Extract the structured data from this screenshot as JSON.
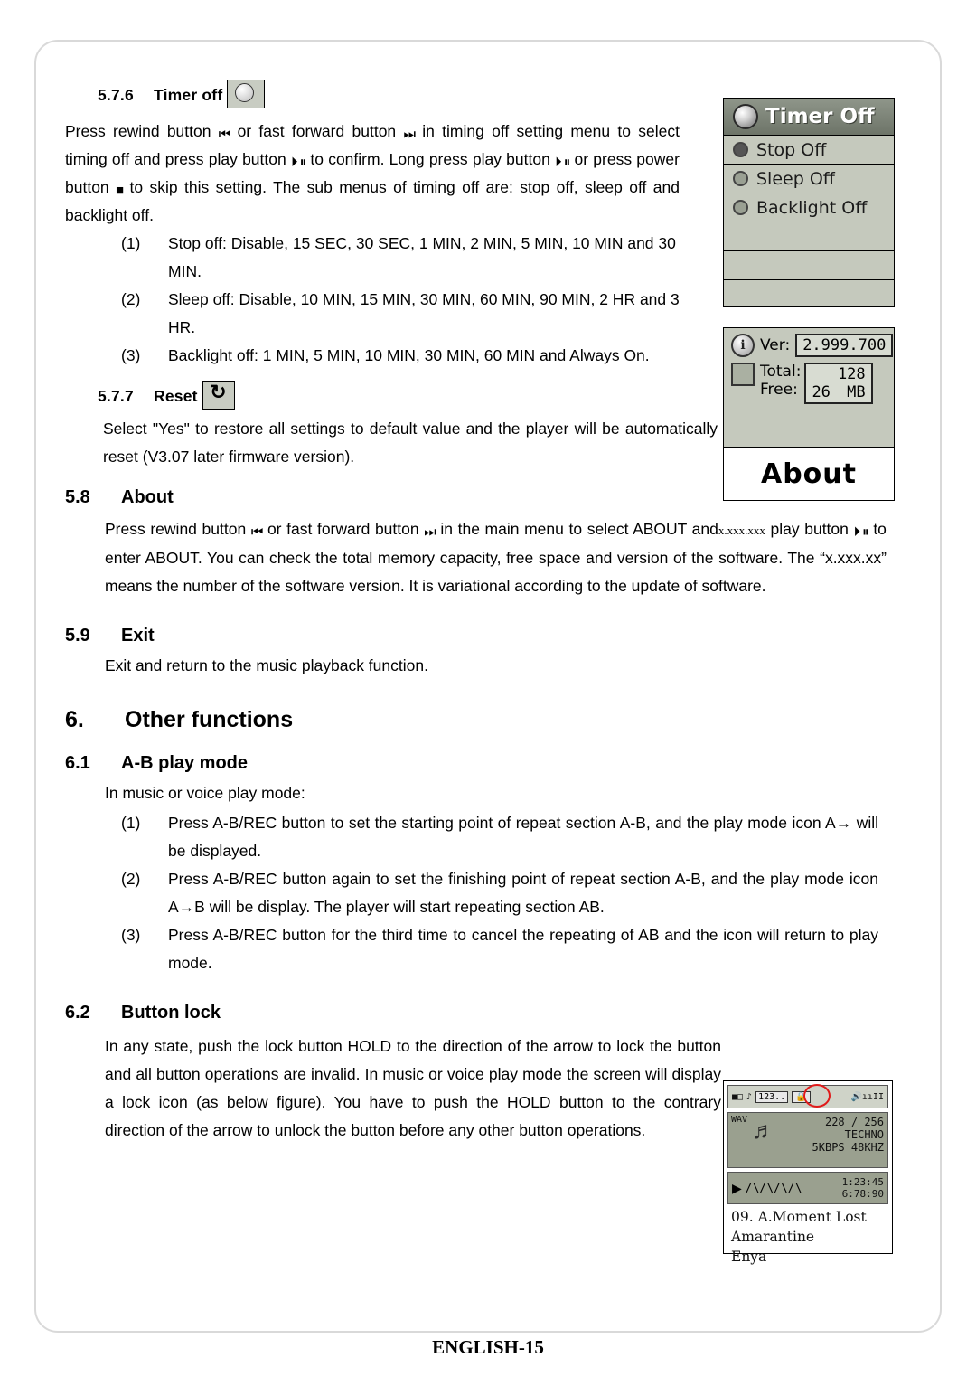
{
  "footer": "ENGLISH-15",
  "sections": {
    "timer_off": {
      "number": "5.7.6",
      "title": "Timer off",
      "icon": "clock-icon",
      "paragraph_parts": {
        "p1": "Press rewind button",
        "p2": "or fast forward button",
        "p3": "in timing off setting menu to select timing off and press play button",
        "p4": "to confirm. Long press play button",
        "p5": "or press power button",
        "p6": "to skip this setting. The sub menus of timing off are: stop off, sleep off and backlight off."
      },
      "list": [
        {
          "mark": "(1)",
          "text": "Stop off: Disable, 15 SEC, 30 SEC, 1 MIN, 2 MIN, 5 MIN, 10 MIN and 30 MIN."
        },
        {
          "mark": "(2)",
          "text": "Sleep off: Disable, 10 MIN, 15 MIN, 30 MIN, 60 MIN, 90 MIN, 2 HR and 3 HR."
        },
        {
          "mark": "(3)",
          "text": "Backlight off: 1 MIN, 5 MIN, 10 MIN, 30 MIN, 60 MIN and Always On."
        }
      ]
    },
    "reset": {
      "number": "5.7.7",
      "title": "Reset",
      "icon": "reset-arrow-icon",
      "text": "Select \"Yes\" to restore all settings to default value and the player will be automatically reset (V3.07 later firmware version)."
    },
    "about": {
      "number": "5.8",
      "title": "About",
      "p1": "Press rewind button",
      "p2": "or fast forward button",
      "p3": "in the main menu to select ABOUT and",
      "p_xbox": "x.xxx.xxx",
      "p4": "play button",
      "p5": "to enter ABOUT. You can check the total memory capacity, free space and version of the software. The “x.xxx.xx” means the number of the software version. It is variational according to the update of software."
    },
    "exit": {
      "number": "5.9",
      "title": "Exit",
      "text": "Exit and return to the music playback function."
    },
    "other_functions": {
      "number": "6.",
      "title": "Other functions"
    },
    "ab_play_mode": {
      "number": "6.1",
      "title": "A-B play mode",
      "intro": "In music or voice play mode:",
      "list": [
        {
          "mark": "(1)",
          "text": "Press A-B/REC button to set the starting point of repeat section A-B, and the play mode icon A→ will be displayed."
        },
        {
          "mark": "(2)",
          "text": "Press A-B/REC button again to set the finishing point of repeat section A-B, and the play mode icon A→B will be display. The player will start repeating section AB."
        },
        {
          "mark": "(3)",
          "text": "Press A-B/REC button for the third time to cancel the repeating of AB and the icon will return to play mode."
        }
      ]
    },
    "button_lock": {
      "number": "6.2",
      "title": "Button lock",
      "text": "In any state, push the lock button HOLD to the direction of the arrow to lock the button and all button operations are invalid. In music or voice play mode the screen will display a lock icon (as below figure). You have to push the HOLD button to the contrary direction of the arrow to unlock the button before any other button operations."
    }
  },
  "figures": {
    "timer_screen": {
      "title": "Timer Off",
      "rows": [
        {
          "label": "Stop Off",
          "selected": true
        },
        {
          "label": "Sleep Off",
          "selected": false
        },
        {
          "label": "Backlight Off",
          "selected": false
        },
        {
          "label": "",
          "selected": false
        },
        {
          "label": "",
          "selected": false
        }
      ]
    },
    "about_screen": {
      "ver_label": "Ver:",
      "ver_value": "2.999.700",
      "total_label": "Total:",
      "free_label": "Free:",
      "total_value": "128",
      "free_value": "26",
      "unit": "MB",
      "title": "About"
    },
    "lock_screen": {
      "tag": "123..",
      "bitrate_line1": "228 / 256",
      "genre": "TECHNO",
      "format": "5KBPS 48KHZ",
      "wav": "WAV",
      "time_top": "1:23:45",
      "time_bottom": "6:78:90",
      "track": "09. A.Moment Lost",
      "album": "Amarantine",
      "artist": "Enya"
    }
  }
}
